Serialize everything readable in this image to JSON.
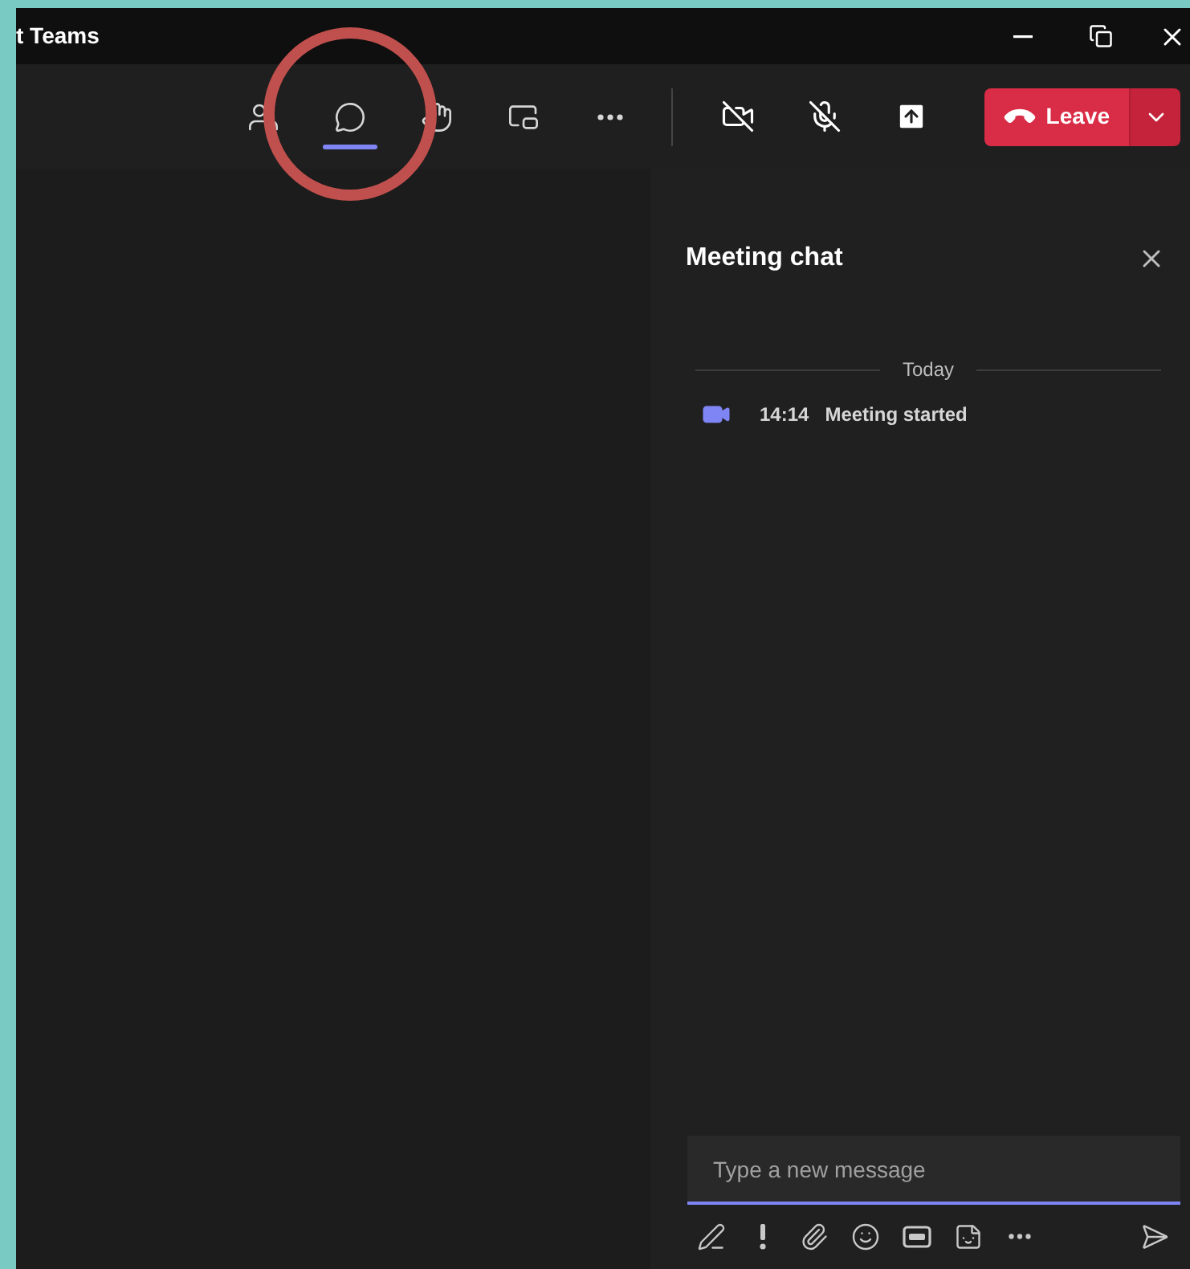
{
  "window": {
    "title": "t Teams"
  },
  "toolbar": {
    "views": [
      {
        "kind": "people",
        "selected": false
      },
      {
        "kind": "chat",
        "selected": true
      },
      {
        "kind": "hand",
        "selected": false
      },
      {
        "kind": "layout",
        "selected": false
      },
      {
        "kind": "more",
        "selected": false
      }
    ],
    "media": [
      {
        "kind": "camera",
        "on": false
      },
      {
        "kind": "mic",
        "on": false
      },
      {
        "kind": "share",
        "on": false
      }
    ],
    "leave": {
      "label": "Leave"
    }
  },
  "chat": {
    "title": "Meeting chat",
    "divider": "Today",
    "events": [
      {
        "time": "14:14",
        "text": "Meeting started"
      }
    ],
    "composer": {
      "placeholder": "Type a new message"
    },
    "tools": [
      {
        "kind": "format"
      },
      {
        "kind": "important"
      },
      {
        "kind": "attach"
      },
      {
        "kind": "emoji"
      },
      {
        "kind": "gif"
      },
      {
        "kind": "sticker"
      },
      {
        "kind": "more"
      },
      {
        "kind": "send"
      }
    ]
  }
}
